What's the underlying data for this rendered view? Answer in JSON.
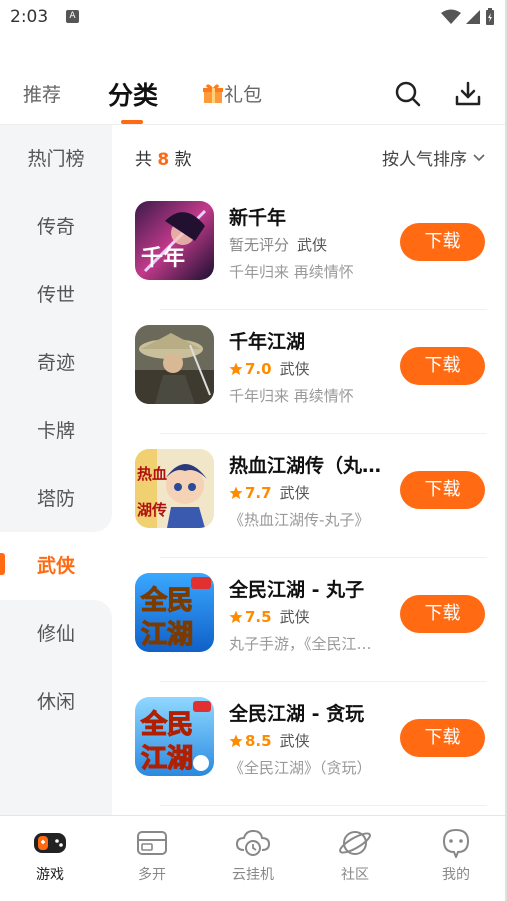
{
  "status": {
    "time": "2:03",
    "notif_letter": "A"
  },
  "tabs": [
    {
      "label": "推荐"
    },
    {
      "label": "分类"
    },
    {
      "label": "礼包"
    }
  ],
  "categories": [
    "热门榜",
    "传奇",
    "传世",
    "奇迹",
    "卡牌",
    "塔防",
    "武侠",
    "修仙",
    "休闲"
  ],
  "active_category": "武侠",
  "list_header": {
    "prefix": "共",
    "count": "8",
    "suffix": "款"
  },
  "sort_label": "按人气排序",
  "games": [
    {
      "name": "新千年",
      "rating": "暂无评分",
      "genre": "武侠",
      "desc": "千年归来 再续情怀",
      "button": "下载"
    },
    {
      "name": "千年江湖",
      "rating": "7.0",
      "genre": "武侠",
      "desc": "千年归来 再续情怀",
      "button": "下载"
    },
    {
      "name": "热血江湖传（丸子）",
      "rating": "7.7",
      "genre": "武侠",
      "desc": "《热血江湖传-丸子》",
      "button": "下载"
    },
    {
      "name": "全民江湖 - 丸子",
      "rating": "7.5",
      "genre": "武侠",
      "desc": "丸子手游，《全民江湖》",
      "button": "下载"
    },
    {
      "name": "全民江湖 - 贪玩",
      "rating": "8.5",
      "genre": "武侠",
      "desc": "《全民江湖》（贪玩）",
      "button": "下载"
    }
  ],
  "bottom_nav": [
    {
      "label": "游戏",
      "icon": "gamepad-icon"
    },
    {
      "label": "多开",
      "icon": "multi-window-icon"
    },
    {
      "label": "云挂机",
      "icon": "cloud-clock-icon"
    },
    {
      "label": "社区",
      "icon": "planet-icon"
    },
    {
      "label": "我的",
      "icon": "profile-icon"
    }
  ],
  "colors": {
    "accent": "#ff6a13",
    "rating": "#ff8c00",
    "sidebar_bg": "#f4f5f7"
  }
}
